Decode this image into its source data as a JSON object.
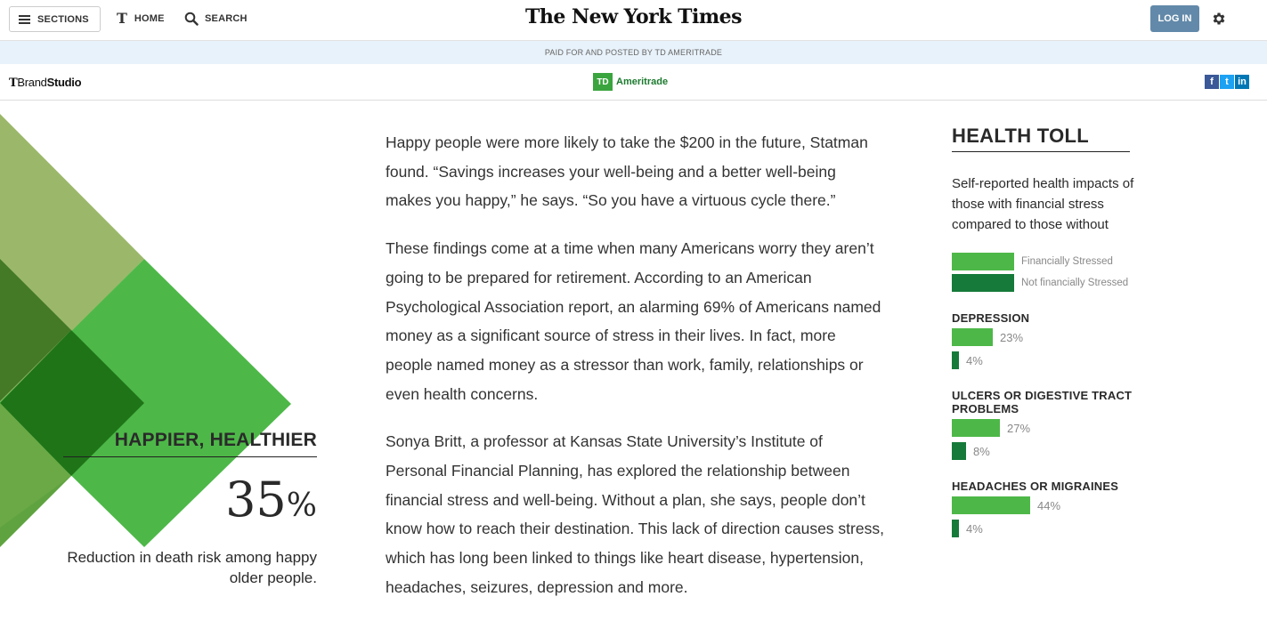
{
  "header": {
    "sections_label": "SECTIONS",
    "home_label": "HOME",
    "search_label": "SEARCH",
    "logo_text": "The New York Times",
    "login_label": "LOG IN"
  },
  "paid_bar": {
    "text": "PAID FOR AND POSTED BY TD AMERITRADE"
  },
  "brand_bar": {
    "brandstudio_t": "T",
    "brandstudio_brand": "Brand",
    "brandstudio_studio": "Studio",
    "sponsor_box": "TD",
    "sponsor_name": "Ameritrade",
    "social": {
      "facebook": "f",
      "twitter": "t",
      "linkedin": "in"
    }
  },
  "left_panel": {
    "title": "HAPPIER, HEALTHIER",
    "stat_value": "35",
    "stat_unit": "%",
    "caption": "Reduction in death risk among happy older people."
  },
  "article": {
    "paragraphs": [
      "Happy people were more likely to take the $200 in the future, Statman found. “Savings increases your well-being and a better well-being makes you happy,” he says. “So you have a virtuous cycle there.”",
      "These findings come at a time when many Americans worry they aren’t going to be prepared for retirement. According to an American Psychological Association report, an alarming 69% of Americans named money as a significant source of stress in their lives. In fact, more people named money as a stressor than work, family, relationships or even health concerns.",
      "Sonya Britt, a professor at Kansas State University’s Institute of Personal Financial Planning, has explored the relationship between financial stress and well-being. Without a plan, she says, people don’t know how to reach their destination. This lack of direction causes stress, which has long been linked to things like heart disease, hypertension, headaches, seizures, depression and more."
    ]
  },
  "sidebar": {
    "title": "HEALTH TOLL",
    "subtitle": "Self-reported health impacts of those with financial stress compared to those without",
    "legend": [
      {
        "label": "Financially Stressed",
        "color": "#4db848"
      },
      {
        "label": "Not financially Stressed",
        "color": "#157a3a"
      }
    ]
  },
  "chart_data": {
    "type": "bar",
    "title": "HEALTH TOLL",
    "subtitle": "Self-reported health impacts of those with financial stress compared to those without",
    "categories": [
      "DEPRESSION",
      "ULCERS OR DIGESTIVE TRACT PROBLEMS",
      "HEADACHES OR MIGRAINES"
    ],
    "series": [
      {
        "name": "Financially Stressed",
        "values": [
          23,
          27,
          44
        ],
        "labels": [
          "23%",
          "27%",
          "44%"
        ],
        "color": "#4db848"
      },
      {
        "name": "Not financially Stressed",
        "values": [
          4,
          8,
          4
        ],
        "labels": [
          "4%",
          "8%",
          "4%"
        ],
        "color": "#157a3a"
      }
    ],
    "unit": "%",
    "orientation": "horizontal",
    "legend_position": "top"
  }
}
